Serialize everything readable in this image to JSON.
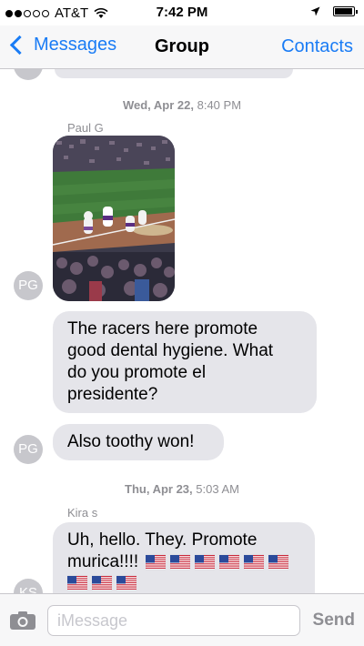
{
  "status_bar": {
    "carrier": "AT&T",
    "time": "7:42 PM",
    "signal_bars_filled": 2,
    "signal_bars_total": 5,
    "battery_level": 0.95,
    "icons": [
      "wifi-icon",
      "location-arrow-icon",
      "battery-icon"
    ]
  },
  "nav": {
    "back_label": "Messages",
    "title": "Group",
    "right_label": "Contacts",
    "accent_color": "#1a7cf5"
  },
  "thread": {
    "timestamp_1": {
      "day": "Wed, Apr 22,",
      "time": "8:40 PM"
    },
    "sender_1": "Paul G",
    "avatar_1": "PG",
    "photo_description_icon": "photo-attachment",
    "message_1": "The racers here promote good dental hygiene. What do you promote el presidente?",
    "message_1_lines": [
      "The racers here promote",
      "good dental hygiene. What",
      "do you promote el",
      "presidente?"
    ],
    "avatar_2": "PG",
    "message_2": "Also toothy won!",
    "timestamp_2": {
      "day": "Thu, Apr 23,",
      "time": "5:03 AM"
    },
    "sender_2": "Kira s",
    "message_3_lines": [
      "Uh, hello. They. Promote",
      "murica!!!!"
    ],
    "message_3_flag_count_line1": 6,
    "message_3_flag_count_line2": 3,
    "avatar_3": "KS",
    "bubble_color": "#e5e5ea",
    "avatar_color": "#c7c7cc"
  },
  "input_bar": {
    "placeholder": "iMessage",
    "send_label": "Send",
    "camera_icon": "camera-icon"
  }
}
